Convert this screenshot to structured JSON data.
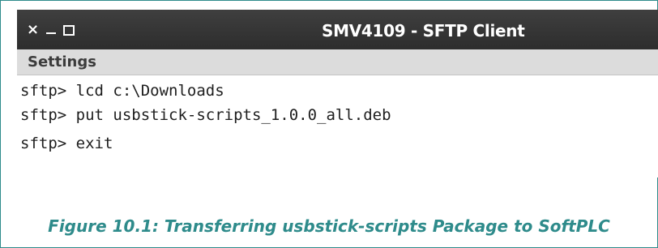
{
  "window": {
    "title": "SMV4109 - SFTP Client",
    "controls": {
      "close": "×",
      "minimize": "minimize",
      "maximize": "maximize"
    }
  },
  "menu": {
    "settings_label": "Settings"
  },
  "terminal": {
    "lines": [
      "sftp> lcd c:\\Downloads",
      "sftp> put usbstick-scripts_1.0.0_all.deb",
      "sftp> exit"
    ]
  },
  "caption": "Figure 10.1: Transferring usbstick-scripts Package to SoftPLC",
  "colors": {
    "accent": "#2e8b8b",
    "titlebar": "#333333",
    "menubar": "#dcdcdc"
  }
}
